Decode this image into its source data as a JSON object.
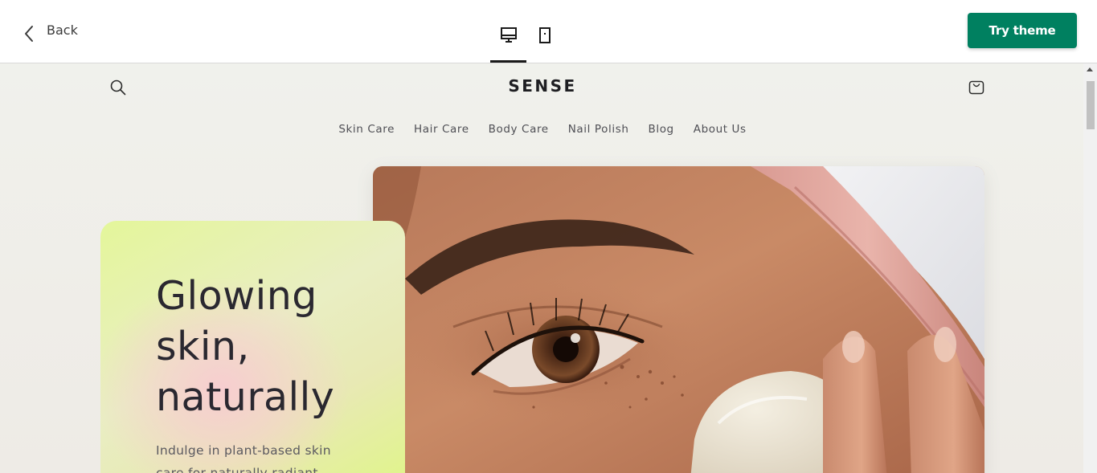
{
  "toolbar": {
    "back_label": "Back",
    "devices": [
      {
        "name": "desktop",
        "active": true
      },
      {
        "name": "mobile",
        "active": false
      }
    ],
    "try_theme_label": "Try theme",
    "try_theme_color": "#008060"
  },
  "store": {
    "logo": "SENSE",
    "menu": [
      {
        "label": "Skin Care"
      },
      {
        "label": "Hair Care"
      },
      {
        "label": "Body Care"
      },
      {
        "label": "Nail Polish"
      },
      {
        "label": "Blog"
      },
      {
        "label": "About Us"
      }
    ],
    "icons": [
      "search-icon",
      "cart-icon"
    ]
  },
  "hero": {
    "title_lines": [
      "Glowing",
      "skin,",
      "naturally"
    ],
    "text": "Indulge in plant-based skin care for naturally radiant",
    "card_colors": [
      "#e4f69a",
      "#f7cdd0"
    ]
  }
}
